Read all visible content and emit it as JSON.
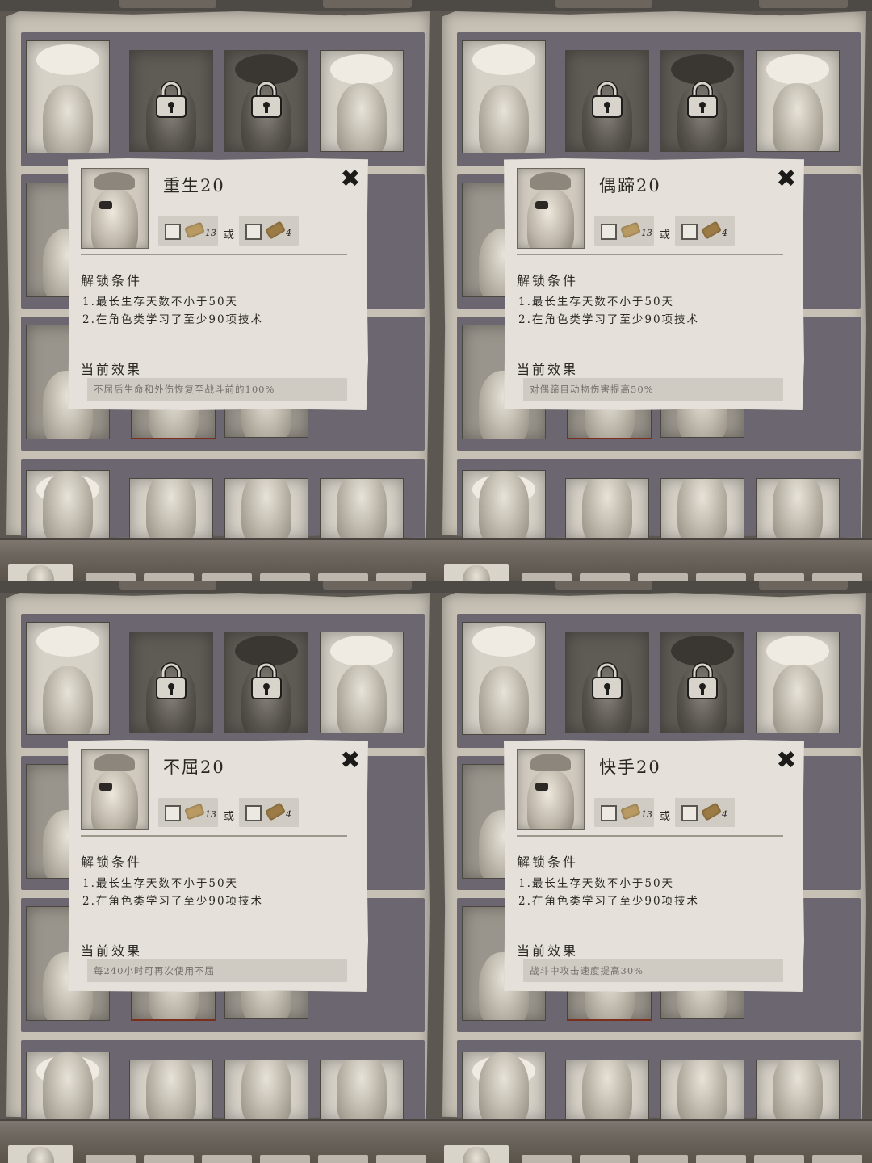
{
  "panels": [
    {
      "title": "重生20",
      "cost_a": "13",
      "or_label": "或",
      "cost_b": "4",
      "conditions_heading": "解锁条件",
      "conditions": [
        "1.最长生存天数不小于50天",
        "2.在角色类学习了至少90项技术"
      ],
      "effect_heading": "当前效果",
      "effect": "不屈后生命和外伤恢复至战斗前的100%"
    },
    {
      "title": "偶蹄20",
      "cost_a": "13",
      "or_label": "或",
      "cost_b": "4",
      "conditions_heading": "解锁条件",
      "conditions": [
        "1.最长生存天数不小于50天",
        "2.在角色类学习了至少90项技术"
      ],
      "effect_heading": "当前效果",
      "effect": "对偶蹄目动物伤害提高50%"
    },
    {
      "title": "不屈20",
      "cost_a": "13",
      "or_label": "或",
      "cost_b": "4",
      "conditions_heading": "解锁条件",
      "conditions": [
        "1.最长生存天数不小于50天",
        "2.在角色类学习了至少90项技术"
      ],
      "effect_heading": "当前效果",
      "effect": "每240小时可再次使用不屈"
    },
    {
      "title": "快手20",
      "cost_a": "13",
      "or_label": "或",
      "cost_b": "4",
      "conditions_heading": "解锁条件",
      "conditions": [
        "1.最长生存天数不小于50天",
        "2.在角色类学习了至少90项技术"
      ],
      "effect_heading": "当前效果",
      "effect": "战斗中攻击速度提高30%"
    }
  ],
  "icons": {
    "close": "close-x-icon",
    "lock": "padlock-icon",
    "cost_a": "paper-scroll-icon",
    "cost_b": "scroll-bundle-icon"
  },
  "colors": {
    "paper": "#c7c1b5",
    "popup": "#e5e1da",
    "band": "#6c6670",
    "frame": "#5c5751"
  }
}
